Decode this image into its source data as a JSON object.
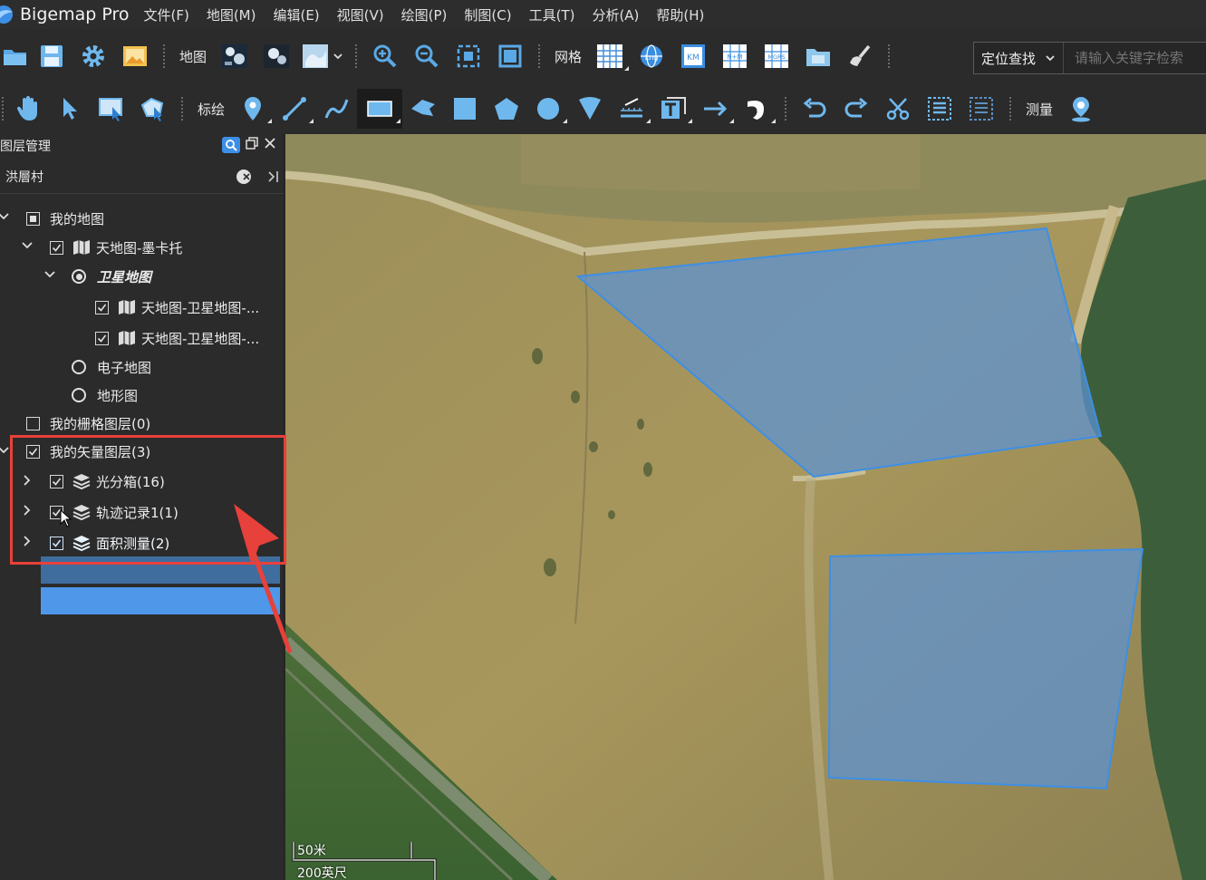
{
  "app": {
    "title": "Bigemap Pro"
  },
  "menu": [
    "文件(F)",
    "地图(M)",
    "编辑(E)",
    "视图(V)",
    "绘图(P)",
    "制图(C)",
    "工具(T)",
    "分析(A)",
    "帮助(H)"
  ],
  "toolbar1": {
    "map_label": "地图",
    "grid_label": "网格",
    "grid_icons": [
      "Lng",
      "KM",
      "N+M",
      "MGRS"
    ],
    "locate_label": "定位查找",
    "search_placeholder": "请输入关键字检索"
  },
  "toolbar2": {
    "draw_label": "标绘",
    "measure_label": "测量"
  },
  "layer_panel": {
    "title": "图层管理",
    "search_value": "洪層村",
    "tree": [
      {
        "label": "我的地图",
        "checked": "partial",
        "expanded": true
      },
      {
        "label": "天地图-墨卡托",
        "checked": true,
        "expanded": true
      },
      {
        "label": "卫星地图",
        "selected": true,
        "expanded": true
      },
      {
        "label": "天地图-卫星地图-...",
        "checked": true
      },
      {
        "label": "天地图-卫星地图-...",
        "checked": true
      },
      {
        "label": "电子地图",
        "selected": false
      },
      {
        "label": "地形图",
        "selected": false
      },
      {
        "label": "我的栅格图层(0)",
        "checked": false
      },
      {
        "label": "我的矢量图层(3)",
        "checked": true,
        "expanded": true
      },
      {
        "label": "光分箱(16)",
        "checked": true
      },
      {
        "label": "轨迹记录1(1)",
        "checked": true,
        "highlight": "hover"
      },
      {
        "label": "面积测量(2)",
        "checked": true,
        "highlight": "selected"
      }
    ]
  },
  "scale_bar": {
    "metric": "50米",
    "imperial": "200英尺"
  },
  "colors": {
    "accent": "#3d8fe6",
    "annotation_red": "#e8403a",
    "polygon_fill": "#5b93d6",
    "selected_row": "#4f97e8",
    "hover_row": "#3f6d9e"
  }
}
